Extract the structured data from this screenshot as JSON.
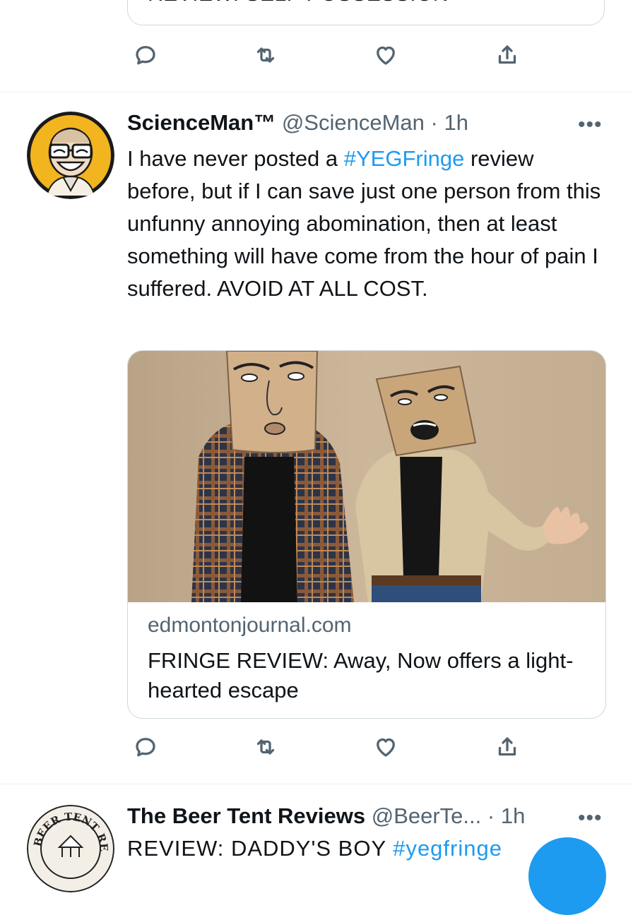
{
  "previous_tweet": {
    "card_title": "REVIEW: SELF POSSESSION"
  },
  "main_tweet": {
    "display_name": "ScienceMan™",
    "handle": "@ScienceMan",
    "separator": "·",
    "time": "1h",
    "more": "•••",
    "text_before": "I have never posted a ",
    "hashtag": "#YEGFringe",
    "text_after": " review before, but if I can save just one person from this unfunny annoying abomination, then at least something will have come from the hour of pain I suffered. AVOID AT ALL COST.",
    "card": {
      "domain": "edmontonjournal.com",
      "title": "FRINGE REVIEW: Away, Now offers a light-hearted escape"
    }
  },
  "next_tweet": {
    "display_name": "The Beer Tent Reviews",
    "handle": "@BeerTe...",
    "separator": "·",
    "time": "1h",
    "more": "•••",
    "avatar_text": "BEER TENT REVIEWS",
    "text_before": "REVIEW: DADDY'S BOY ",
    "hashtag": "#yegfringe"
  },
  "icons": [
    "reply-icon",
    "retweet-icon",
    "like-icon",
    "share-icon",
    "more-icon"
  ],
  "colors": {
    "link": "#1d9bf0",
    "muted": "#536471",
    "text": "#0f1419",
    "border": "#cfd9de"
  }
}
